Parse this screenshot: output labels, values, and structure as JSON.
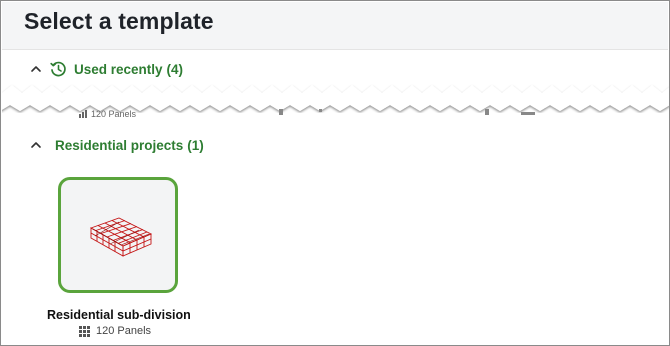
{
  "page": {
    "title": "Select a template"
  },
  "sections": {
    "recent": {
      "label": "Used recently",
      "count": "(4)",
      "icon": "history-icon",
      "expanded": true,
      "partial_meta": "120 Panels"
    },
    "residential": {
      "label": "Residential projects",
      "count": "(1)",
      "expanded": true,
      "templates": [
        {
          "name": "Residential sub-division",
          "meta": "120 Panels",
          "meta_icon": "grid-icon",
          "selected": true,
          "thumbnail": "red wireframe building model"
        }
      ]
    }
  },
  "colors": {
    "accent_green": "#2e7d32",
    "card_border": "#5aa43c",
    "header_bg": "#f4f5f6",
    "model_red": "#c41414"
  }
}
